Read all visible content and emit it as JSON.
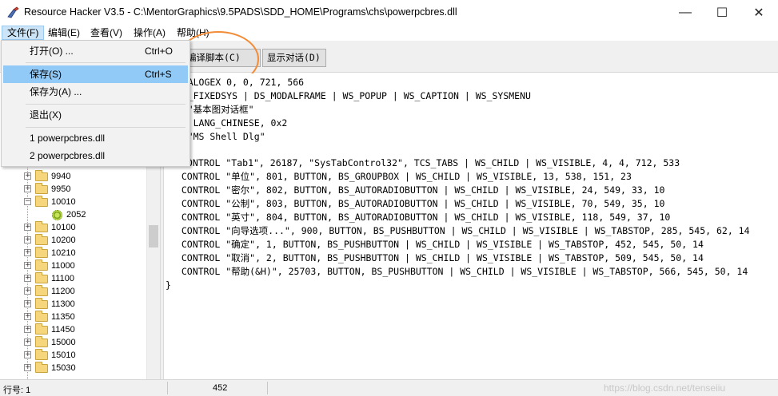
{
  "window": {
    "title": "Resource Hacker V3.5  -  C:\\MentorGraphics\\9.5PADS\\SDD_HOME\\Programs\\chs\\powerpcbres.dll",
    "minimize": "—",
    "maximize": "☐",
    "close": "✕"
  },
  "menubar": {
    "items": [
      "文件(F)",
      "编辑(E)",
      "查看(V)",
      "操作(A)",
      "帮助(H)"
    ],
    "active_index": 0
  },
  "toolbar": {
    "compile_label": "编译脚本(C)",
    "show_dialog_label": "显示对话(D)",
    "accent_color": "#f28c38"
  },
  "file_menu": {
    "items": [
      {
        "label": "打开(O) ...",
        "shortcut": "Ctrl+O"
      },
      {
        "label": "保存(S)",
        "shortcut": "Ctrl+S"
      },
      {
        "label": "保存为(A) ...",
        "shortcut": ""
      },
      {
        "label": "退出(X)",
        "shortcut": ""
      },
      {
        "label": "1  powerpcbres.dll",
        "shortcut": ""
      },
      {
        "label": "2  powerpcbres.dll",
        "shortcut": ""
      }
    ],
    "hovered_index": 1
  },
  "tree": {
    "nodes": [
      {
        "label": "9940",
        "expander": "+"
      },
      {
        "label": "9950",
        "expander": "+"
      },
      {
        "label": "10010",
        "expander": "−"
      },
      {
        "label": "2052",
        "expander": "",
        "leaf": true
      },
      {
        "label": "10100",
        "expander": "+"
      },
      {
        "label": "10200",
        "expander": "+"
      },
      {
        "label": "10210",
        "expander": "+"
      },
      {
        "label": "11000",
        "expander": "+"
      },
      {
        "label": "11100",
        "expander": "+"
      },
      {
        "label": "11200",
        "expander": "+"
      },
      {
        "label": "11300",
        "expander": "+"
      },
      {
        "label": "11350",
        "expander": "+"
      },
      {
        "label": "11450",
        "expander": "+"
      },
      {
        "label": "15000",
        "expander": "+"
      },
      {
        "label": "15010",
        "expander": "+"
      },
      {
        "label": "15030",
        "expander": "+"
      }
    ]
  },
  "editor": {
    "lines": [
      "0 DIALOGEX 0, 0, 721, 566",
      "E DS_FIXEDSYS | DS_MODALFRAME | WS_POPUP | WS_CAPTION | WS_SYSMENU",
      "ION \"基本图对话框\"",
      "UAGE LANG_CHINESE, 0x2",
      " 8, \"MS Shell Dlg\"",
      "",
      "CONTROL \"Tab1\", 26187, \"SysTabControl32\", TCS_TABS | WS_CHILD | WS_VISIBLE, 4, 4, 712, 533",
      "  CONTROL \"单位\", 801, BUTTON, BS_GROUPBOX | WS_CHILD | WS_VISIBLE, 13, 538, 151, 23",
      "  CONTROL \"密尔\", 802, BUTTON, BS_AUTORADIOBUTTON | WS_CHILD | WS_VISIBLE, 24, 549, 33, 10",
      "  CONTROL \"公制\", 803, BUTTON, BS_AUTORADIOBUTTON | WS_CHILD | WS_VISIBLE, 70, 549, 35, 10",
      "  CONTROL \"英寸\", 804, BUTTON, BS_AUTORADIOBUTTON | WS_CHILD | WS_VISIBLE, 118, 549, 37, 10",
      "  CONTROL \"向导选项...\", 900, BUTTON, BS_PUSHBUTTON | WS_CHILD | WS_VISIBLE | WS_TABSTOP, 285, 545, 62, 14",
      "  CONTROL \"确定\", 1, BUTTON, BS_PUSHBUTTON | WS_CHILD | WS_VISIBLE | WS_TABSTOP, 452, 545, 50, 14",
      "  CONTROL \"取消\", 2, BUTTON, BS_PUSHBUTTON | WS_CHILD | WS_VISIBLE | WS_TABSTOP, 509, 545, 50, 14",
      "  CONTROL \"帮助(&H)\", 25703, BUTTON, BS_PUSHBUTTON | WS_CHILD | WS_VISIBLE | WS_TABSTOP, 566, 545, 50, 14",
      "}"
    ]
  },
  "statusbar": {
    "line_label": "行号: 1",
    "position": "452",
    "watermark": "https://blog.csdn.net/tenseiiu"
  }
}
